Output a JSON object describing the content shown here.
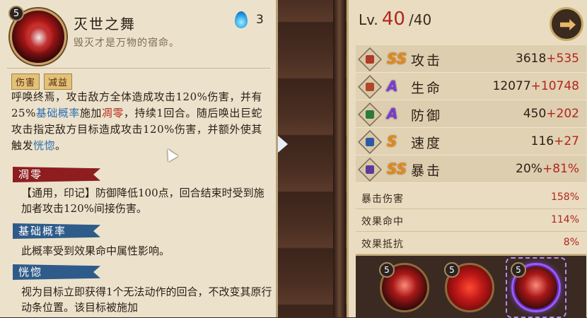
{
  "skill": {
    "level": "5",
    "name": "灭世之舞",
    "quote": "毁灭才是万物的宿命。",
    "orb_cost": "3",
    "tags": [
      "伤害",
      "减益"
    ],
    "desc_parts": [
      {
        "t": "呼唤终焉，攻击敌方全体造成攻击120%伤害，并有25%",
        "c": ""
      },
      {
        "t": "基础概率",
        "c": "kw-blue"
      },
      {
        "t": "施加",
        "c": ""
      },
      {
        "t": "凋零",
        "c": "kw-red"
      },
      {
        "t": "，持续1回合。随后唤出巨蛇攻击指定敌方目标造成攻击120%伤害，并额外使其触发",
        "c": ""
      },
      {
        "t": "恍惚",
        "c": "kw-blue"
      },
      {
        "t": "。",
        "c": ""
      }
    ],
    "sections": [
      {
        "title": "凋零",
        "color": "red",
        "text": "【通用，印记】防御降低100点，回合结束时受到施加者攻击120%间接伤害。"
      },
      {
        "title": "基础概率",
        "color": "blue",
        "text": "此概率受到效果命中属性影响。"
      },
      {
        "title": "恍惚",
        "color": "blue",
        "text": "视为目标立即获得1个无法动作的回合，不改变其原行动条位置。该目标被施加"
      }
    ]
  },
  "character": {
    "lv_label": "Lv.",
    "lv_current": "40",
    "lv_max": "/40",
    "share_icon": "share-icon",
    "stats": [
      {
        "name": "攻击",
        "grade": "SS",
        "base": "3618",
        "bonus": "+535",
        "icon": "attack-icon",
        "color": "#b03a2a"
      },
      {
        "name": "生命",
        "grade": "A",
        "base": "12077",
        "bonus": "+10748",
        "icon": "hp-icon",
        "color": "#b0462a"
      },
      {
        "name": "防御",
        "grade": "A",
        "base": "450",
        "bonus": "+202",
        "icon": "defense-icon",
        "color": "#2a7a3a"
      },
      {
        "name": "速度",
        "grade": "S",
        "base": "116",
        "bonus": "+27",
        "icon": "speed-icon",
        "color": "#2a5aa8"
      },
      {
        "name": "暴击",
        "grade": "SS",
        "base": "20%",
        "bonus": "+81%",
        "icon": "crit-icon",
        "color": "#5a3a9a"
      }
    ],
    "sub_stats": [
      {
        "name": "暴击伤害",
        "value": "158%"
      },
      {
        "name": "效果命中",
        "value": "114%"
      },
      {
        "name": "效果抵抗",
        "value": "8%"
      }
    ],
    "skill_slots": [
      {
        "level": "5",
        "icon": "skill-1-icon"
      },
      {
        "level": "5",
        "icon": "skill-2-icon"
      },
      {
        "level": "5",
        "icon": "skill-3-icon"
      }
    ]
  }
}
